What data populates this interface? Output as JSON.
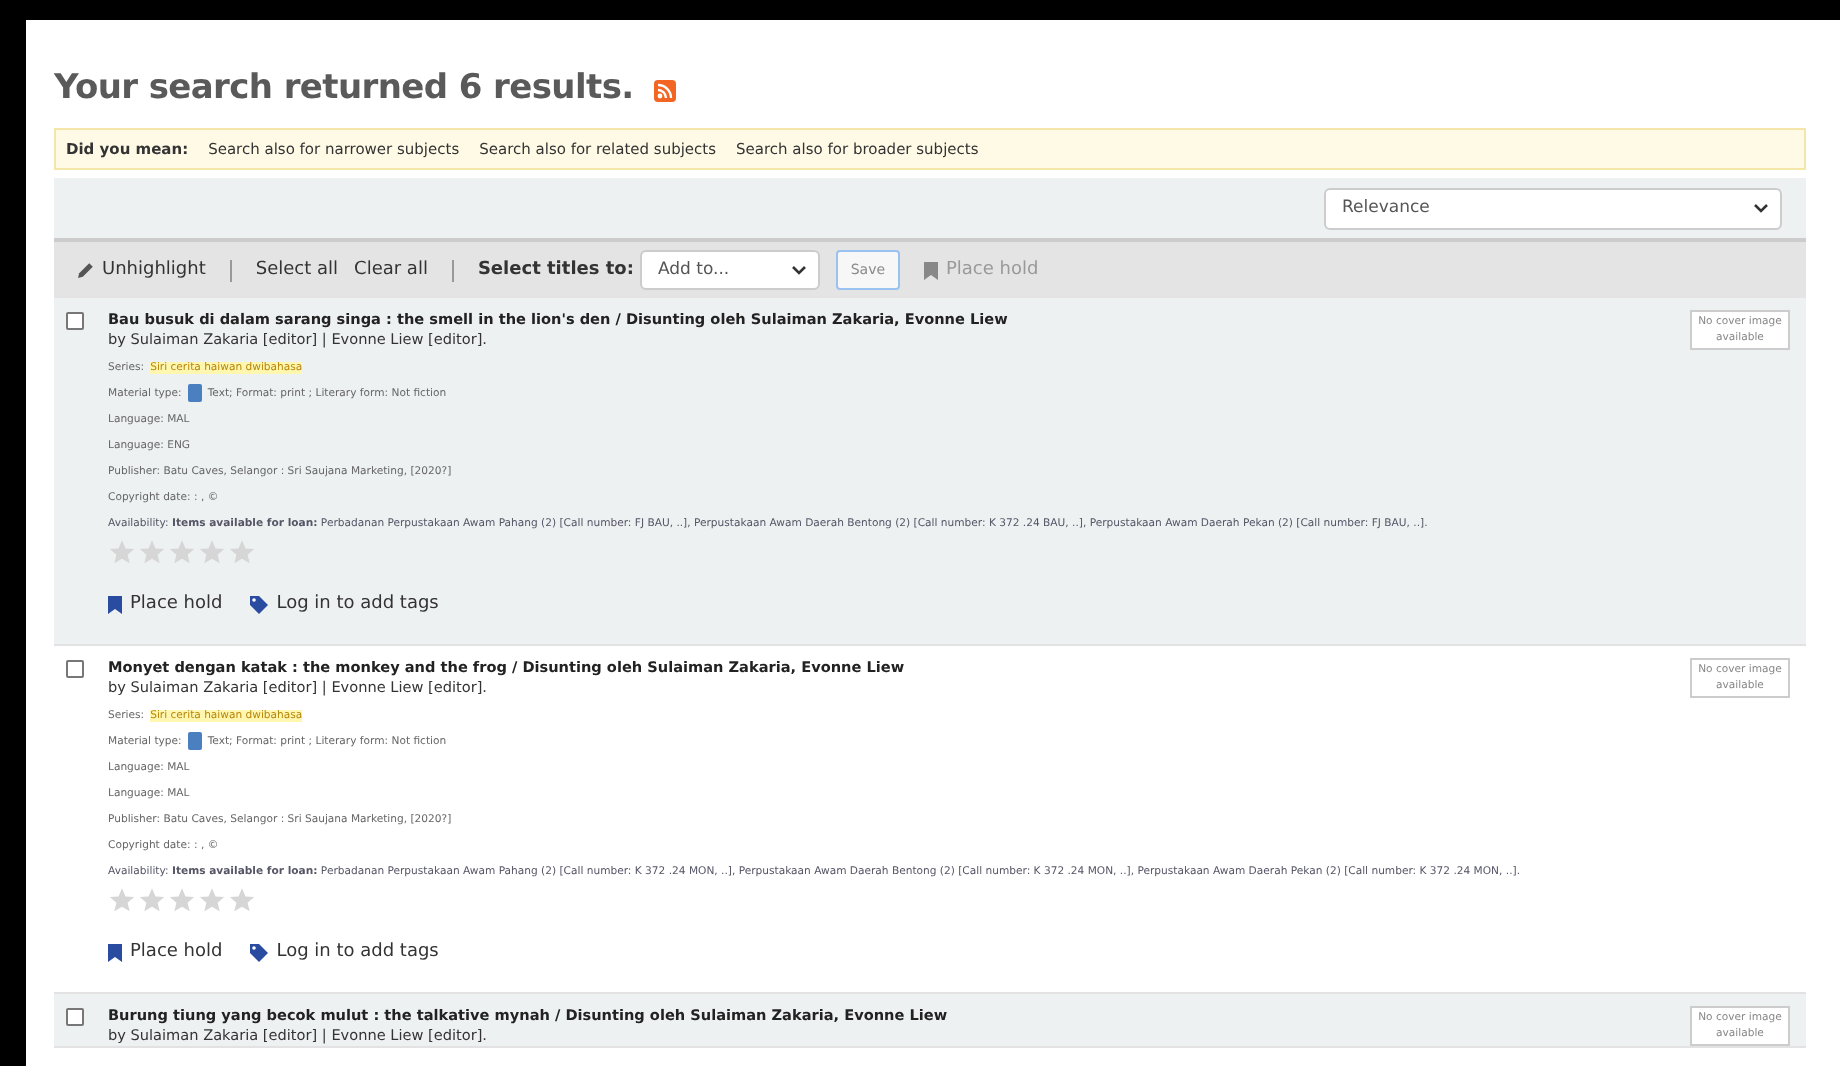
{
  "heading": "Your search returned 6 results.",
  "did_you_mean": {
    "label": "Did you mean:",
    "links": [
      "Search also for narrower subjects",
      "Search also for related subjects",
      "Search also for broader subjects"
    ]
  },
  "sort": {
    "value": "Relevance"
  },
  "toolbar": {
    "unhighlight": "Unhighlight",
    "select_all": "Select all",
    "clear_all": "Clear all",
    "select_titles_label": "Select titles to:",
    "list_select": "Add to...",
    "save": {
      "label": "Save",
      "disabled": true
    },
    "place_hold": {
      "label": "Place hold",
      "disabled": true
    }
  },
  "results": [
    {
      "checked": false,
      "title": "Bau busuk di dalam sarang singa : the smell in the lion's den / Disunting oleh Sulaiman Zakaria, Evonne Liew",
      "byline": "by Sulaiman Zakaria [editor] | Evonne Liew [editor].",
      "series_label": "Series:",
      "series": "Siri cerita haiwan dwibahasa",
      "material_label": "Material type:",
      "material": "Text; Format: print ; Literary form: Not fiction",
      "details": [
        "Language: MAL",
        "Language: ENG",
        "Publisher: Batu Caves, Selangor : Sri Saujana Marketing, [2020?]",
        "Copyright date: : , ©"
      ],
      "availability": "Availability: **Items available for loan:** Perbadanan Perpustakaan Awam Pahang (2) [Call number: FJ BAU, ..], Perpustakaan Awam Daerah Bentong (2) [Call number: K 372 .24 BAU, ..], Perpustakaan Awam Daerah Pekan (2) [Call number: FJ BAU, ..].",
      "stars": 0,
      "actions": [
        "Place hold",
        "Log in to add tags"
      ],
      "cover": "No cover image available"
    },
    {
      "checked": false,
      "title": "Monyet dengan katak : the monkey and the frog / Disunting oleh Sulaiman Zakaria, Evonne Liew",
      "byline": "by Sulaiman Zakaria [editor] | Evonne Liew [editor].",
      "series_label": "Series:",
      "series": "Siri cerita haiwan dwibahasa",
      "material_label": "Material type:",
      "material": "Text; Format: print ; Literary form: Not fiction",
      "details": [
        "Language: MAL",
        "Language: MAL",
        "Publisher: Batu Caves, Selangor : Sri Saujana Marketing, [2020?]",
        "Copyright date: : , ©"
      ],
      "availability": "Availability: **Items available for loan:** Perbadanan Perpustakaan Awam Pahang (2) [Call number: K 372 .24 MON, ..], Perpustakaan Awam Daerah Bentong (2) [Call number: K 372 .24 MON, ..], Perpustakaan Awam Daerah Pekan (2) [Call number: K 372 .24 MON, ..].",
      "stars": 0,
      "actions": [
        "Place hold",
        "Log in to add tags"
      ],
      "cover": "No cover image available"
    },
    {
      "checked": false,
      "title": "Burung tiung yang becok mulut : the talkative mynah / Disunting oleh Sulaiman Zakaria, Evonne Liew",
      "byline": "by Sulaiman Zakaria [editor] | Evonne Liew [editor].",
      "cover": "No cover image available"
    }
  ]
}
